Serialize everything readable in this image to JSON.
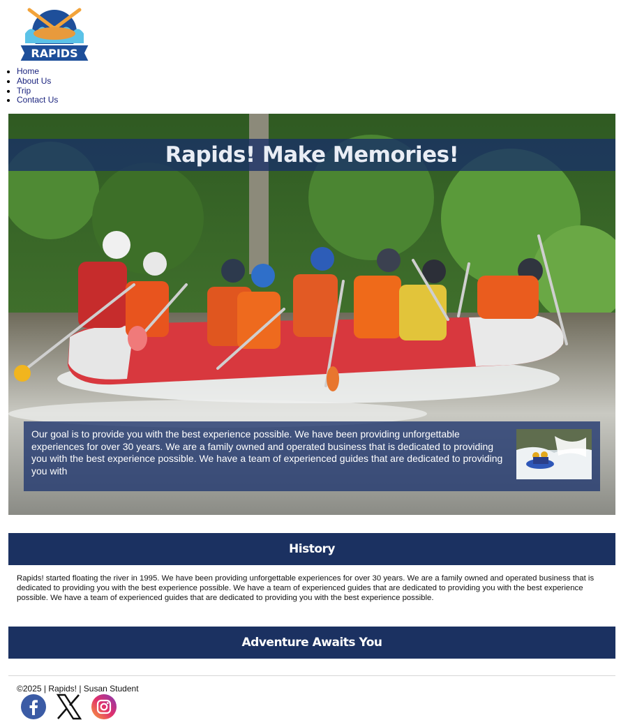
{
  "logo": {
    "text": "RAPIDS"
  },
  "nav": {
    "items": [
      {
        "label": "Home"
      },
      {
        "label": "About Us"
      },
      {
        "label": "Trip"
      },
      {
        "label": "Contact Us"
      }
    ]
  },
  "hero": {
    "title": "Rapids! Make Memories!",
    "goal_text": "Our goal is to provide you with the best experience possible. We have been providing unforgettable experiences for over 30 years. We are a family owned and operated business that is dedicated to providing you with the best experience possible. We have a team of experienced guides that are dedicated to providing you with"
  },
  "history": {
    "heading": "History",
    "body": "Rapids! started floating the river in 1995. We have been providing unforgettable experiences for over 30 years. We are a family owned and operated business that is dedicated to providing you with the best experience possible. We have a team of experienced guides that are dedicated to providing you with the best experience possible. We have a team of experienced guides that are dedicated to providing you with the best experience possible."
  },
  "adventure": {
    "heading": "Adventure Awaits You"
  },
  "footer": {
    "text": "©2025 | Rapids! | Susan Student",
    "social": [
      {
        "icon": "facebook-icon"
      },
      {
        "icon": "x-icon"
      },
      {
        "icon": "instagram-icon"
      }
    ]
  },
  "colors": {
    "navy": "#1b3161",
    "link": "#1a237e"
  }
}
